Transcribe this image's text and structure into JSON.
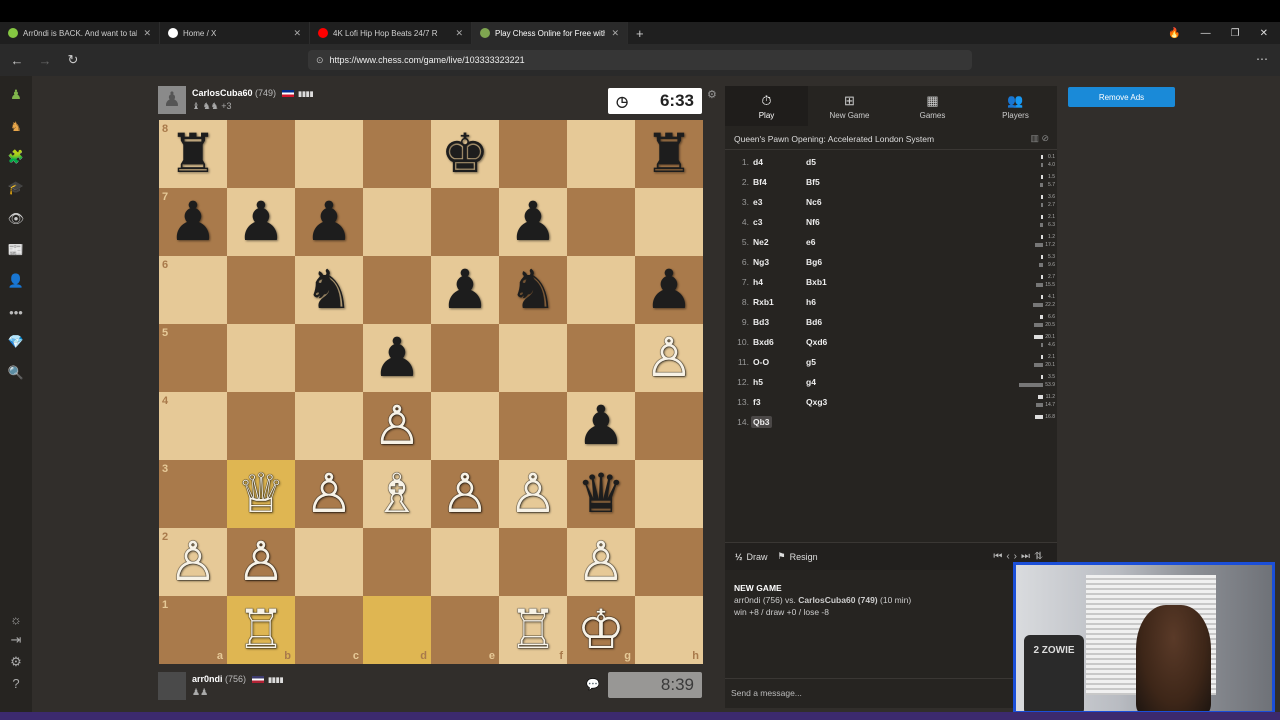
{
  "browser": {
    "tabs": [
      {
        "label": "Arr0ndi is BACK. And want to talk and",
        "icon": "rumble-icon",
        "color": "#85c742",
        "active": false
      },
      {
        "label": "Home / X",
        "icon": "x-icon",
        "color": "#ffffff",
        "active": false
      },
      {
        "label": "4K  Lofi Hip Hop Beats 24/7 R",
        "icon": "youtube-icon",
        "color": "#ff0000",
        "active": false
      },
      {
        "label": "Play Chess Online for Free with Fr",
        "icon": "chess-icon",
        "color": "#7fa650",
        "active": true
      }
    ],
    "new_tab": "+",
    "url": "https://www.chess.com/game/live/103333323221"
  },
  "opponent": {
    "name": "CarlosCuba60",
    "rating": "(749)",
    "flag_colors": [
      "#002a8f",
      "#ffffff",
      "#cf142b"
    ],
    "captured": "♝ ♞♞",
    "advantage": "+3",
    "clock": "6:33"
  },
  "player": {
    "name": "arr0ndi",
    "rating": "(756)",
    "flag_colors": [
      "#3c3b6e",
      "#ffffff",
      "#b22234"
    ],
    "captured": "♟♟",
    "clock": "8:39"
  },
  "board": {
    "files": [
      "a",
      "b",
      "c",
      "d",
      "e",
      "f",
      "g",
      "h"
    ],
    "ranks": [
      "8",
      "7",
      "6",
      "5",
      "4",
      "3",
      "2",
      "1"
    ],
    "highlights": [
      "b3",
      "b1",
      "d1"
    ],
    "pieces": [
      {
        "sq": "a8",
        "p": "♜",
        "c": "b"
      },
      {
        "sq": "e8",
        "p": "♚",
        "c": "b"
      },
      {
        "sq": "h8",
        "p": "♜",
        "c": "b"
      },
      {
        "sq": "a7",
        "p": "♟",
        "c": "b"
      },
      {
        "sq": "b7",
        "p": "♟",
        "c": "b"
      },
      {
        "sq": "c7",
        "p": "♟",
        "c": "b"
      },
      {
        "sq": "f7",
        "p": "♟",
        "c": "b"
      },
      {
        "sq": "c6",
        "p": "♞",
        "c": "b"
      },
      {
        "sq": "e6",
        "p": "♟",
        "c": "b"
      },
      {
        "sq": "f6",
        "p": "♞",
        "c": "b"
      },
      {
        "sq": "h6",
        "p": "♟",
        "c": "b"
      },
      {
        "sq": "d5",
        "p": "♟",
        "c": "b"
      },
      {
        "sq": "h5",
        "p": "♙",
        "c": "w"
      },
      {
        "sq": "d4",
        "p": "♙",
        "c": "w"
      },
      {
        "sq": "g4",
        "p": "♟",
        "c": "b"
      },
      {
        "sq": "b3",
        "p": "♕",
        "c": "w"
      },
      {
        "sq": "c3",
        "p": "♙",
        "c": "w"
      },
      {
        "sq": "d3",
        "p": "♗",
        "c": "w"
      },
      {
        "sq": "e3",
        "p": "♙",
        "c": "w"
      },
      {
        "sq": "f3",
        "p": "♙",
        "c": "w"
      },
      {
        "sq": "g3",
        "p": "♛",
        "c": "b"
      },
      {
        "sq": "a2",
        "p": "♙",
        "c": "w"
      },
      {
        "sq": "b2",
        "p": "♙",
        "c": "w"
      },
      {
        "sq": "g2",
        "p": "♙",
        "c": "w"
      },
      {
        "sq": "b1",
        "p": "♖",
        "c": "w"
      },
      {
        "sq": "f1",
        "p": "♖",
        "c": "w"
      },
      {
        "sq": "g1",
        "p": "♔",
        "c": "w"
      }
    ]
  },
  "panel": {
    "tabs": [
      {
        "label": "Play",
        "icon": "⏱"
      },
      {
        "label": "New Game",
        "icon": "⊞"
      },
      {
        "label": "Games",
        "icon": "▦"
      },
      {
        "label": "Players",
        "icon": "👥"
      }
    ],
    "remove_ads": "Remove Ads",
    "opening": "Queen's Pawn Opening: Accelerated London System",
    "moves": [
      {
        "n": "1.",
        "w": "d4",
        "b": "d5",
        "tw": "0.1",
        "tb": "4.0"
      },
      {
        "n": "2.",
        "w": "Bf4",
        "b": "Bf5",
        "tw": "1.5",
        "tb": "5.7"
      },
      {
        "n": "3.",
        "w": "e3",
        "b": "Nc6",
        "tw": "3.6",
        "tb": "2.7"
      },
      {
        "n": "4.",
        "w": "c3",
        "b": "Nf6",
        "tw": "2.1",
        "tb": "6.3"
      },
      {
        "n": "5.",
        "w": "Ne2",
        "b": "e6",
        "tw": "1.2",
        "tb": "17.2"
      },
      {
        "n": "6.",
        "w": "Ng3",
        "b": "Bg6",
        "tw": "5.3",
        "tb": "9.6"
      },
      {
        "n": "7.",
        "w": "h4",
        "b": "Bxb1",
        "tw": "2.7",
        "tb": "15.5"
      },
      {
        "n": "8.",
        "w": "Rxb1",
        "b": "h6",
        "tw": "4.1",
        "tb": "22.2"
      },
      {
        "n": "9.",
        "w": "Bd3",
        "b": "Bd6",
        "tw": "6.6",
        "tb": "20.5"
      },
      {
        "n": "10.",
        "w": "Bxd6",
        "b": "Qxd6",
        "tw": "20.1",
        "tb": "4.6"
      },
      {
        "n": "11.",
        "w": "O-O",
        "b": "g5",
        "tw": "2.1",
        "tb": "20.1"
      },
      {
        "n": "12.",
        "w": "h5",
        "b": "g4",
        "tw": "3.5",
        "tb": "53.9"
      },
      {
        "n": "13.",
        "w": "f3",
        "b": "Qxg3",
        "tw": "11.2",
        "tb": "14.7"
      },
      {
        "n": "14.",
        "w": "Qb3",
        "b": "",
        "tw": "16.8",
        "tb": ""
      }
    ],
    "draw": "Draw",
    "resign": "Resign",
    "game_title": "NEW GAME",
    "game_players_a": "arr0ndi (756) vs.",
    "game_players_b": "CarlosCuba60 (749)",
    "game_players_c": "(10 min)",
    "game_stakes": "win +8 / draw +0 / lose -8",
    "chat_placeholder": "Send a message..."
  },
  "webcam": {
    "brand": "2 ZOWIE"
  }
}
